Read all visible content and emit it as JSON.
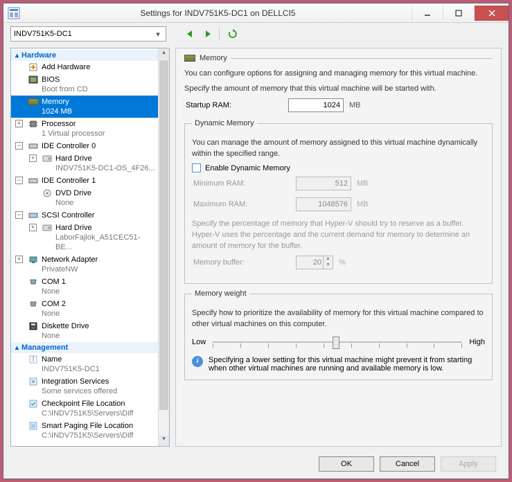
{
  "titlebar": {
    "title": "Settings for INDV751K5-DC1 on DELLCI5"
  },
  "toolbar": {
    "vm_selector": "INDV751K5-DC1"
  },
  "tree": {
    "section_hardware": "Hardware",
    "section_management": "Management",
    "add_hardware": "Add Hardware",
    "bios": "BIOS",
    "bios_sub": "Boot from CD",
    "memory": "Memory",
    "memory_sub": "1024 MB",
    "processor": "Processor",
    "processor_sub": "1 Virtual processor",
    "ide0": "IDE Controller 0",
    "ide0_hd": "Hard Drive",
    "ide0_hd_sub": "INDV751K5-DC1-OS_4F26...",
    "ide1": "IDE Controller 1",
    "ide1_dvd": "DVD Drive",
    "ide1_dvd_sub": "None",
    "scsi": "SCSI Controller",
    "scsi_hd": "Hard Drive",
    "scsi_hd_sub": "LaborFajlok_A51CEC51-BE...",
    "net": "Network Adapter",
    "net_sub": "PrivateNW",
    "com1": "COM 1",
    "com1_sub": "None",
    "com2": "COM 2",
    "com2_sub": "None",
    "diskette": "Diskette Drive",
    "diskette_sub": "None",
    "name": "Name",
    "name_sub": "INDV751K5-DC1",
    "integ": "Integration Services",
    "integ_sub": "Some services offered",
    "checkpoint": "Checkpoint File Location",
    "checkpoint_sub": "C:\\INDV751K5\\Servers\\Diff",
    "smartpaging": "Smart Paging File Location",
    "smartpaging_sub": "C:\\INDV751K5\\Servers\\Diff"
  },
  "panel": {
    "heading": "Memory",
    "intro": "You can configure options for assigning and managing memory for this virtual machine.",
    "startup_desc": "Specify the amount of memory that this virtual machine will be started with.",
    "startup_label": "Startup RAM:",
    "startup_value": "1024",
    "mb": "MB",
    "dyn_legend": "Dynamic Memory",
    "dyn_desc": "You can manage the amount of memory assigned to this virtual machine dynamically within the specified range.",
    "dyn_enable": "Enable Dynamic Memory",
    "min_label": "Minimum RAM:",
    "min_value": "512",
    "max_label": "Maximum RAM:",
    "max_value": "1048576",
    "buffer_desc": "Specify the percentage of memory that Hyper-V should try to reserve as a buffer. Hyper-V uses the percentage and the current demand for memory to determine an amount of memory for the buffer.",
    "buffer_label": "Memory buffer:",
    "buffer_value": "20",
    "pct": "%",
    "weight_legend": "Memory weight",
    "weight_desc": "Specify how to prioritize the availability of memory for this virtual machine compared to other virtual machines on this computer.",
    "low": "Low",
    "high": "High",
    "info": "Specifying a lower setting for this virtual machine might prevent it from starting when other virtual machines are running and available memory is low."
  },
  "footer": {
    "ok": "OK",
    "cancel": "Cancel",
    "apply": "Apply"
  }
}
